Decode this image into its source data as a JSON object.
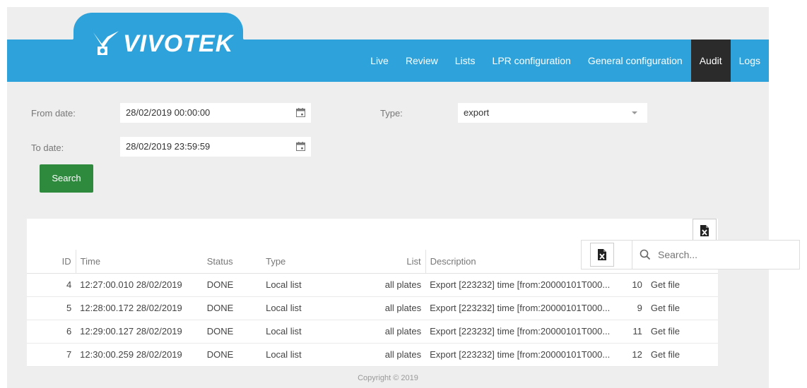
{
  "brand": {
    "name": "VIVOTEK"
  },
  "nav": {
    "items": [
      {
        "label": "Live"
      },
      {
        "label": "Review"
      },
      {
        "label": "Lists"
      },
      {
        "label": "LPR configuration"
      },
      {
        "label": "General configuration"
      },
      {
        "label": "Audit",
        "active": true
      },
      {
        "label": "Logs"
      }
    ]
  },
  "filters": {
    "from_label": "From date:",
    "from_value": "28/02/2019 00:00:00",
    "to_label": "To date:",
    "to_value": "28/02/2019 23:59:59",
    "type_label": "Type:",
    "type_value": "export",
    "search_button": "Search"
  },
  "table": {
    "columns": [
      "ID",
      "Time",
      "Status",
      "Type",
      "List",
      "Description"
    ],
    "rows": [
      {
        "id": "4",
        "time": "12:27:00.010 28/02/2019",
        "status": "DONE",
        "type": "Local list",
        "list": "all plates",
        "description": "Export [223232] time [from:20000101T000...",
        "count": "10",
        "action": "Get file"
      },
      {
        "id": "5",
        "time": "12:28:00.172 28/02/2019",
        "status": "DONE",
        "type": "Local list",
        "list": "all plates",
        "description": "Export [223232] time [from:20000101T000...",
        "count": "9",
        "action": "Get file"
      },
      {
        "id": "6",
        "time": "12:29:00.127 28/02/2019",
        "status": "DONE",
        "type": "Local list",
        "list": "all plates",
        "description": "Export [223232] time [from:20000101T000...",
        "count": "11",
        "action": "Get file"
      },
      {
        "id": "7",
        "time": "12:30:00.259 28/02/2019",
        "status": "DONE",
        "type": "Local list",
        "list": "all plates",
        "description": "Export [223232] time [from:20000101T000...",
        "count": "12",
        "action": "Get file"
      }
    ]
  },
  "search": {
    "placeholder": "Search..."
  },
  "icons": {
    "export": "excel-export-icon",
    "search": "search-icon",
    "calendar": "calendar-icon"
  },
  "colors": {
    "header": "#2ea3db",
    "active_nav": "#2b2b2b",
    "button": "#2e8b3e",
    "link": "#2a8cd1"
  },
  "footer": {
    "copyright": "Copyright © 2019"
  }
}
